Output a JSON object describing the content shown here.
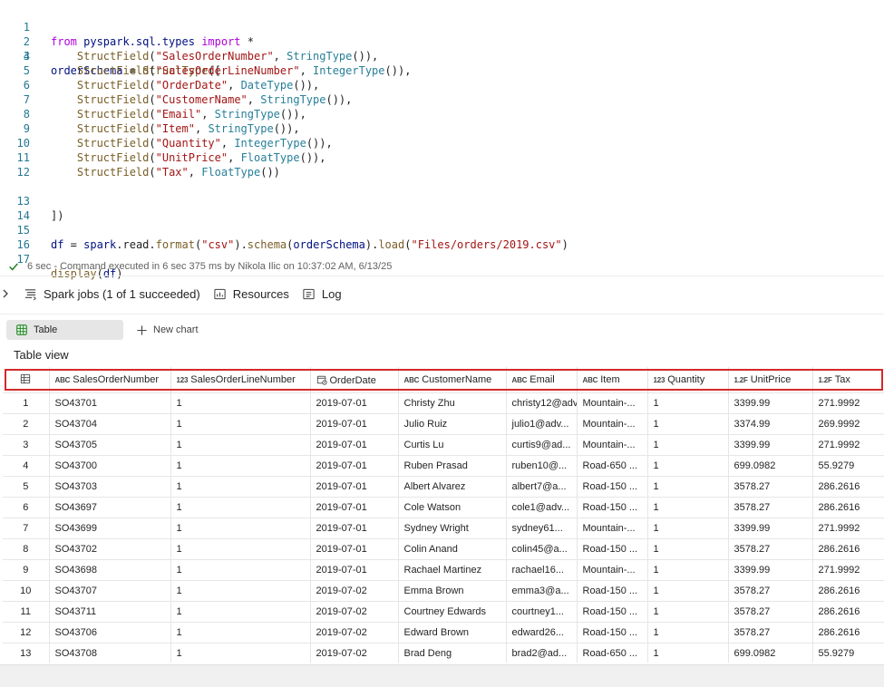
{
  "code": {
    "lines": [
      {
        "n": "1"
      },
      {
        "n": "2"
      },
      {
        "n": "3"
      },
      {
        "n": "4"
      },
      {
        "n": "5"
      },
      {
        "n": "6"
      },
      {
        "n": "7"
      },
      {
        "n": "8"
      },
      {
        "n": "9"
      },
      {
        "n": "10"
      },
      {
        "n": "11"
      },
      {
        "n": "12"
      },
      {
        "n": "13"
      },
      {
        "n": "14"
      },
      {
        "n": "15"
      },
      {
        "n": "16"
      },
      {
        "n": "17"
      }
    ],
    "l1": {
      "kw1": "from",
      "mod": " pyspark.sql.types ",
      "kw2": "import",
      "rest": " *"
    },
    "l3": {
      "var": "orderSchema",
      "eq": " = ",
      "fn": "StructType",
      "rest": "(["
    },
    "fields": [
      {
        "name": "\"SalesOrderNumber\"",
        "type": "StringType"
      },
      {
        "name": "\"SalesOrderLineNumber\"",
        "type": "IntegerType"
      },
      {
        "name": "\"OrderDate\"",
        "type": "DateType"
      },
      {
        "name": "\"CustomerName\"",
        "type": "StringType"
      },
      {
        "name": "\"Email\"",
        "type": "StringType"
      },
      {
        "name": "\"Item\"",
        "type": "StringType"
      },
      {
        "name": "\"Quantity\"",
        "type": "IntegerType"
      },
      {
        "name": "\"UnitPrice\"",
        "type": "FloatType"
      },
      {
        "name": "\"Tax\"",
        "type": "FloatType"
      }
    ],
    "struct_field": "StructField",
    "l13": "])",
    "l15": {
      "var": "df",
      "eq": " = ",
      "spark": "spark",
      "read": ".read.",
      "format": "format",
      "arg1": "\"csv\"",
      "schema": "schema",
      "svar": "orderSchema",
      "load": "load",
      "arg2": "\"Files/orders/2019.csv\""
    },
    "l17": {
      "fn": "display",
      "arg": "df"
    }
  },
  "status": {
    "duration": "6 sec",
    "text": " - Command executed in 6 sec 375 ms by Nikola Ilic on 10:37:02 AM, 6/13/25"
  },
  "jobs_bar": {
    "spark_jobs": "Spark jobs (1 of 1 succeeded)",
    "resources": "Resources",
    "log": "Log"
  },
  "toolbar": {
    "table_tab": "Table",
    "new_chart": "New chart"
  },
  "table_view_label": "Table view",
  "columns": [
    {
      "badge": "ABC",
      "name": "SalesOrderNumber"
    },
    {
      "badge": "123",
      "name": "SalesOrderLineNumber"
    },
    {
      "badge": "",
      "name": "OrderDate"
    },
    {
      "badge": "ABC",
      "name": "CustomerName"
    },
    {
      "badge": "ABC",
      "name": "Email"
    },
    {
      "badge": "ABC",
      "name": "Item"
    },
    {
      "badge": "123",
      "name": "Quantity"
    },
    {
      "badge": "1.2F",
      "name": "UnitPrice"
    },
    {
      "badge": "1.2F",
      "name": "Tax"
    }
  ],
  "rows": [
    [
      "1",
      "SO43701",
      "1",
      "2019-07-01",
      "Christy Zhu",
      "christy12@adv...",
      "Mountain-...",
      "1",
      "3399.99",
      "271.9992"
    ],
    [
      "2",
      "SO43704",
      "1",
      "2019-07-01",
      "Julio Ruiz",
      "julio1@adv...",
      "Mountain-...",
      "1",
      "3374.99",
      "269.9992"
    ],
    [
      "3",
      "SO43705",
      "1",
      "2019-07-01",
      "Curtis Lu",
      "curtis9@ad...",
      "Mountain-...",
      "1",
      "3399.99",
      "271.9992"
    ],
    [
      "4",
      "SO43700",
      "1",
      "2019-07-01",
      "Ruben Prasad",
      "ruben10@...",
      "Road-650 ...",
      "1",
      "699.0982",
      "55.9279"
    ],
    [
      "5",
      "SO43703",
      "1",
      "2019-07-01",
      "Albert Alvarez",
      "albert7@a...",
      "Road-150 ...",
      "1",
      "3578.27",
      "286.2616"
    ],
    [
      "6",
      "SO43697",
      "1",
      "2019-07-01",
      "Cole Watson",
      "cole1@adv...",
      "Road-150 ...",
      "1",
      "3578.27",
      "286.2616"
    ],
    [
      "7",
      "SO43699",
      "1",
      "2019-07-01",
      "Sydney Wright",
      "sydney61...",
      "Mountain-...",
      "1",
      "3399.99",
      "271.9992"
    ],
    [
      "8",
      "SO43702",
      "1",
      "2019-07-01",
      "Colin Anand",
      "colin45@a...",
      "Road-150 ...",
      "1",
      "3578.27",
      "286.2616"
    ],
    [
      "9",
      "SO43698",
      "1",
      "2019-07-01",
      "Rachael Martinez",
      "rachael16...",
      "Mountain-...",
      "1",
      "3399.99",
      "271.9992"
    ],
    [
      "10",
      "SO43707",
      "1",
      "2019-07-02",
      "Emma Brown",
      "emma3@a...",
      "Road-150 ...",
      "1",
      "3578.27",
      "286.2616"
    ],
    [
      "11",
      "SO43711",
      "1",
      "2019-07-02",
      "Courtney Edwards",
      "courtney1...",
      "Road-150 ...",
      "1",
      "3578.27",
      "286.2616"
    ],
    [
      "12",
      "SO43706",
      "1",
      "2019-07-02",
      "Edward Brown",
      "edward26...",
      "Road-150 ...",
      "1",
      "3578.27",
      "286.2616"
    ],
    [
      "13",
      "SO43708",
      "1",
      "2019-07-02",
      "Brad Deng",
      "brad2@ad...",
      "Road-650 ...",
      "1",
      "699.0982",
      "55.9279"
    ]
  ]
}
